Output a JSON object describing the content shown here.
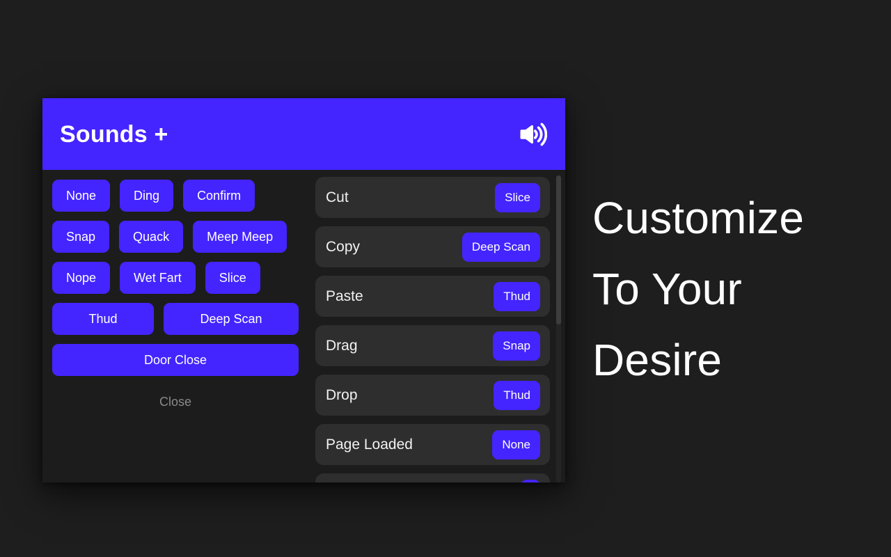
{
  "page": {
    "background_color": "#1e1e1e",
    "accent_color": "#4425FF"
  },
  "headline": {
    "line1": "Customize",
    "line2": "To Your",
    "line3": "Desire"
  },
  "dialog": {
    "title": "Sounds +",
    "header_icon": "speaker-volume-icon",
    "sound_picker": {
      "rows": [
        [
          {
            "label": "None"
          },
          {
            "label": "Ding"
          },
          {
            "label": "Confirm"
          }
        ],
        [
          {
            "label": "Snap"
          },
          {
            "label": "Quack"
          },
          {
            "label": "Meep Meep"
          }
        ],
        [
          {
            "label": "Nope"
          },
          {
            "label": "Wet Fart"
          },
          {
            "label": "Slice"
          }
        ],
        [
          {
            "label": "Thud"
          },
          {
            "label": "Deep Scan"
          }
        ],
        [
          {
            "label": "Door Close"
          }
        ]
      ]
    },
    "close_label": "Close",
    "mappings": [
      {
        "event": "Cut",
        "sound": "Slice"
      },
      {
        "event": "Copy",
        "sound": "Deep Scan"
      },
      {
        "event": "Paste",
        "sound": "Thud"
      },
      {
        "event": "Drag",
        "sound": "Snap"
      },
      {
        "event": "Drop",
        "sound": "Thud"
      },
      {
        "event": "Page Loaded",
        "sound": "None"
      }
    ],
    "scrollbar": {
      "orientation": "vertical"
    }
  }
}
